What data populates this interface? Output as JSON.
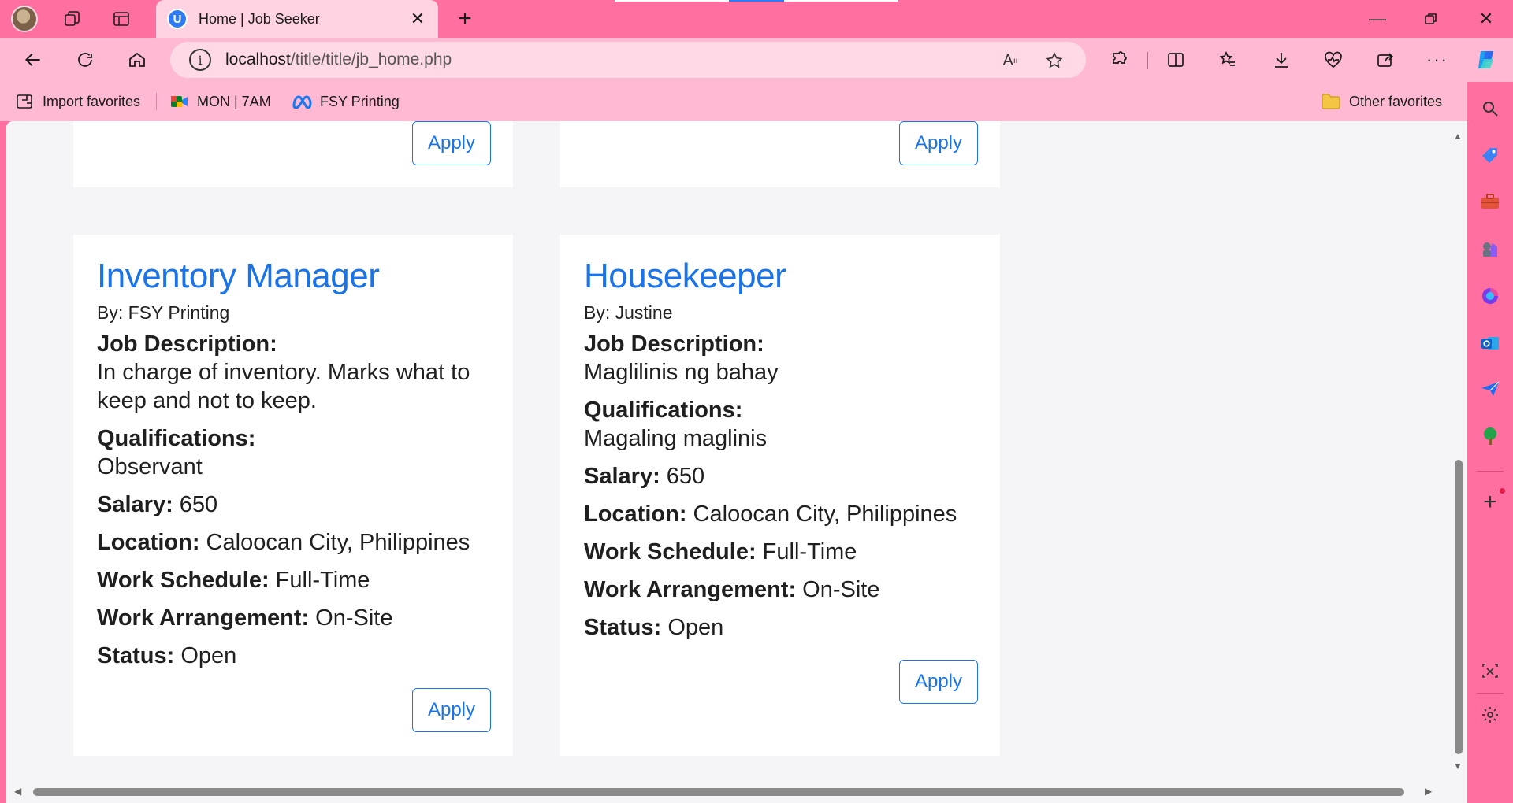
{
  "browser": {
    "tab_title": "Home | Job Seeker",
    "favicon_letter": "U",
    "url_host": "localhost",
    "url_path": "/title/title/jb_home.php"
  },
  "favorites": {
    "items": [
      {
        "label": "Import favorites",
        "icon": "import-favorites-icon"
      },
      {
        "label": "MON | 7AM",
        "icon": "google-meet-icon"
      },
      {
        "label": "FSY Printing",
        "icon": "meta-icon"
      }
    ],
    "other": "Other favorites"
  },
  "labels": {
    "by_prefix": "By: ",
    "job_description": "Job Description:",
    "qualifications": "Qualifications:",
    "salary": "Salary:",
    "location": "Location:",
    "work_schedule": "Work Schedule:",
    "work_arrangement": "Work Arrangement:",
    "status": "Status:",
    "apply": "Apply"
  },
  "jobs": [
    {
      "title": "Inventory Manager",
      "by": "By: FSY Printing",
      "description": "In charge of inventory. Marks what to keep and not to keep.",
      "qualifications": "Observant",
      "salary": " 650",
      "location": " Caloocan City, Philippines",
      "work_schedule": " Full-Time",
      "work_arrangement": " On-Site",
      "status": " Open"
    },
    {
      "title": "Housekeeper",
      "by": "By: Justine",
      "description": "Maglilinis ng bahay",
      "qualifications": "Magaling maglinis",
      "salary": " 650",
      "location": " Caloocan City, Philippines",
      "work_schedule": " Full-Time",
      "work_arrangement": " On-Site",
      "status": " Open"
    }
  ]
}
